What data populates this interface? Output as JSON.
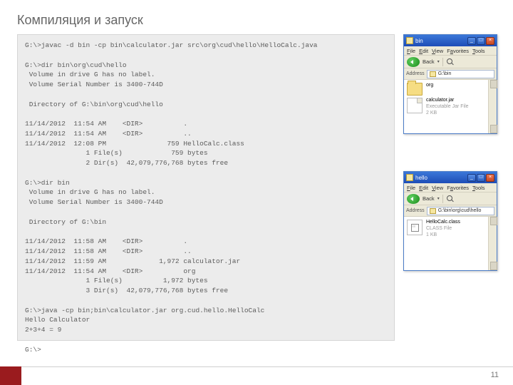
{
  "slide": {
    "title": "Компиляция и запуск",
    "page_number": "11"
  },
  "console_text": "G:\\>javac -d bin -cp bin\\calculator.jar src\\org\\cud\\hello\\HelloCalc.java\n\nG:\\>dir bin\\org\\cud\\hello\n Volume in drive G has no label.\n Volume Serial Number is 3400-744D\n\n Directory of G:\\bin\\org\\cud\\hello\n\n11/14/2012  11:54 AM    <DIR>          .\n11/14/2012  11:54 AM    <DIR>          ..\n11/14/2012  12:08 PM               759 HelloCalc.class\n               1 File(s)            759 bytes\n               2 Dir(s)  42,079,776,768 bytes free\n\nG:\\>dir bin\n Volume in drive G has no label.\n Volume Serial Number is 3400-744D\n\n Directory of G:\\bin\n\n11/14/2012  11:58 AM    <DIR>          .\n11/14/2012  11:58 AM    <DIR>          ..\n11/14/2012  11:59 AM             1,972 calculator.jar\n11/14/2012  11:54 AM    <DIR>          org\n               1 File(s)          1,972 bytes\n               3 Dir(s)  42,079,776,768 bytes free\n\nG:\\>java -cp bin;bin\\calculator.jar org.cud.hello.HelloCalc\nHello Calculator\n2+3+4 = 9\n\nG:\\>",
  "explorer": {
    "menu": {
      "file": "File",
      "edit": "Edit",
      "view": "View",
      "favorites": "Favorites",
      "tools": "Tools"
    },
    "toolbar": {
      "back": "Back"
    },
    "address_label": "Address",
    "bin": {
      "title": "bin",
      "path": "G:\\bin",
      "items": [
        {
          "name": "org",
          "type": "folder"
        },
        {
          "name": "calculator.jar",
          "type": "jar",
          "meta1": "Executable Jar File",
          "meta2": "2 KB"
        }
      ]
    },
    "hello": {
      "title": "hello",
      "path": "G:\\bin\\org\\cud\\hello",
      "items": [
        {
          "name": "HelloCalc.class",
          "type": "class",
          "meta1": "CLASS File",
          "meta2": "1 KB"
        }
      ]
    }
  }
}
